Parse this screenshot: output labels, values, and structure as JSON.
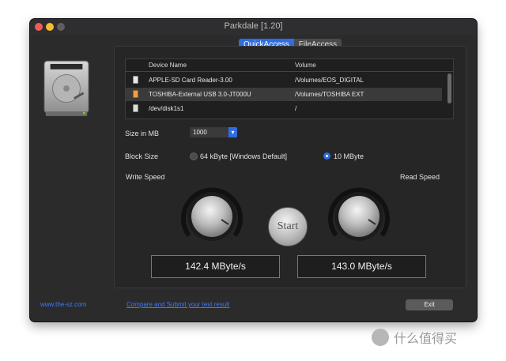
{
  "window": {
    "title": "Parkdale [1.20]"
  },
  "tabs": [
    {
      "label": "QuickAccess",
      "active": true
    },
    {
      "label": "FileAccess",
      "active": false
    }
  ],
  "devices": {
    "headers": [
      "Device Name",
      "Volume"
    ],
    "rows": [
      {
        "name": "APPLE-SD Card Reader-3.00",
        "volume": "/Volumes/EOS_DIGITAL",
        "icon": "sd-card-icon",
        "selected": false
      },
      {
        "name": "TOSHIBA-External USB 3.0-JT000U",
        "volume": "/Volumes/TOSHIBA EXT",
        "icon": "external-drive-icon",
        "selected": true
      },
      {
        "name": "/dev/disk1s1",
        "volume": "/",
        "icon": "internal-disk-icon",
        "selected": false
      }
    ]
  },
  "size": {
    "label": "Size in MB",
    "value": "1000"
  },
  "block": {
    "label": "Block Size",
    "option1": "64 kByte [Windows Default]",
    "option2": "10 MByte",
    "selected": "option2"
  },
  "speed": {
    "write_label": "Write Speed",
    "read_label": "Read Speed",
    "start_label": "Start",
    "write_value": "142.4 MByte/s",
    "read_value": "143.0 MByte/s"
  },
  "footer": {
    "website": "www.the-sz.com",
    "compare_link": "Compare and Submit your test result",
    "exit_label": "Exit"
  },
  "watermark": {
    "text": "什么值得买"
  },
  "colors": {
    "accent": "#2e6de2",
    "link": "#3b7cff",
    "window_bg": "#2b2b2c"
  }
}
